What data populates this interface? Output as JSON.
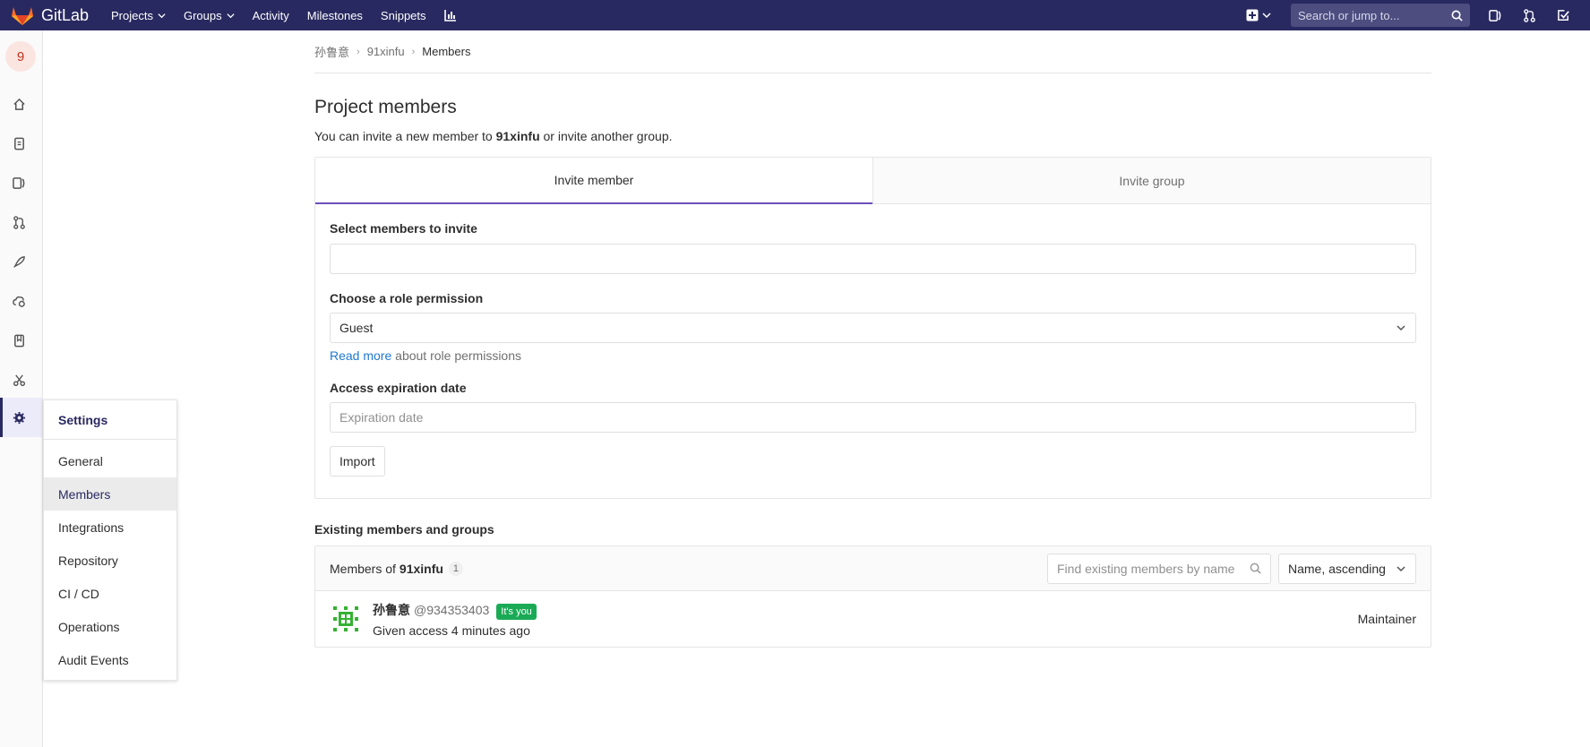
{
  "navbar": {
    "brand": "GitLab",
    "links": [
      {
        "label": "Projects",
        "dropdown": true
      },
      {
        "label": "Groups",
        "dropdown": true
      },
      {
        "label": "Activity",
        "dropdown": false
      },
      {
        "label": "Milestones",
        "dropdown": false
      },
      {
        "label": "Snippets",
        "dropdown": false
      }
    ],
    "search_placeholder": "Search or jump to..."
  },
  "sidebar": {
    "project_avatar_letter": "9",
    "icons": [
      "home-icon",
      "repository-icon",
      "issues-icon",
      "merge-request-icon",
      "ci-cd-icon",
      "operations-icon",
      "wiki-icon",
      "snippets-icon",
      "settings-icon"
    ]
  },
  "flyout": {
    "title": "Settings",
    "items": [
      "General",
      "Members",
      "Integrations",
      "Repository",
      "CI / CD",
      "Operations",
      "Audit Events"
    ],
    "active": "Members"
  },
  "breadcrumb": {
    "items": [
      "孙鲁意",
      "91xinfu",
      "Members"
    ]
  },
  "page": {
    "title": "Project members",
    "lead_prefix": "You can invite a new member to ",
    "lead_project": "91xinfu",
    "lead_suffix": " or invite another group."
  },
  "tabs": {
    "invite_member": "Invite member",
    "invite_group": "Invite group"
  },
  "form": {
    "select_label": "Select members to invite",
    "role_label": "Choose a role permission",
    "role_value": "Guest",
    "read_more": "Read more",
    "read_more_suffix": " about role permissions",
    "expiration_label": "Access expiration date",
    "expiration_placeholder": "Expiration date",
    "import_button": "Import"
  },
  "existing": {
    "title": "Existing members and groups",
    "members_of_prefix": "Members of ",
    "project": "91xinfu",
    "count": "1",
    "find_placeholder": "Find existing members by name",
    "sort_value": "Name, ascending",
    "members": [
      {
        "name": "孙鲁意",
        "handle": "@934353403",
        "badge": "It's you",
        "access": "Given access 4 minutes ago",
        "role": "Maintainer"
      }
    ]
  },
  "colors": {
    "navbar": "#292961",
    "accent": "#6b4fbb",
    "link": "#1f78d1",
    "badge_green": "#1aaa55"
  }
}
